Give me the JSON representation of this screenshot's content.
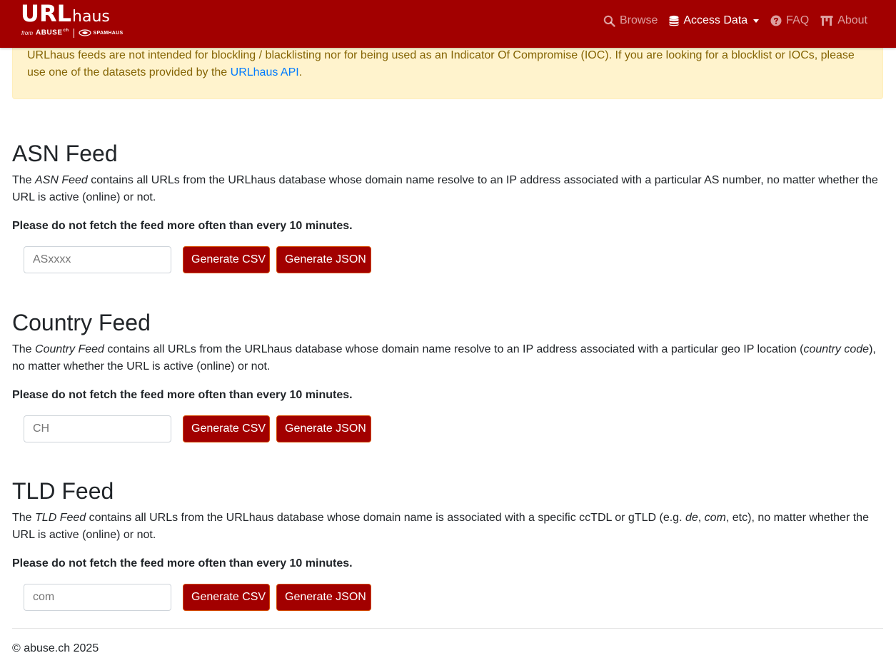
{
  "nav": {
    "brand": {
      "title_url": "URL",
      "title_haus": "haus",
      "from": "from",
      "abuse": "ABUSE",
      "abuse_ch": "ch",
      "spamhaus": "SPAMHAUS"
    },
    "items": [
      {
        "label": "Browse",
        "icon": "search-icon",
        "active": false
      },
      {
        "label": "Access Data",
        "icon": "database-icon",
        "active": true
      },
      {
        "label": "FAQ",
        "icon": "question-circle-icon",
        "active": false
      },
      {
        "label": "About",
        "icon": "building-icon",
        "active": false
      }
    ]
  },
  "alert": {
    "text": "URLhaus feeds are not intended for blockling / blacklisting nor for being used as an Indicator Of Compromise (IOC). If you are looking for a blocklist or IOCs, please use one of the datasets provided by the ",
    "link": "URLhaus API",
    "end": "."
  },
  "sections": {
    "asn": {
      "title": "ASN Feed",
      "desc_pre": "The ",
      "desc_em": "ASN Feed",
      "desc_post": " contains all URLs from the URLhaus database whose domain name resolve to an IP address associated with a particular AS number, no matter whether the URL is active (online) or not.",
      "warning": "Please do not fetch the feed more often than every 10 minutes.",
      "placeholder": "ASxxxx",
      "csv": "Generate CSV",
      "json": "Generate JSON"
    },
    "country": {
      "title": "Country Feed",
      "desc_pre": "The ",
      "desc_em": "Country Feed",
      "desc_mid": " contains all URLs from the URLhaus database whose domain name resolve to an IP address associated with a particular geo IP location (",
      "desc_em2": "country code",
      "desc_post": "), no matter whether the URL is active (online) or not.",
      "warning": "Please do not fetch the feed more often than every 10 minutes.",
      "placeholder": "CH",
      "csv": "Generate CSV",
      "json": "Generate JSON"
    },
    "tld": {
      "title": "TLD Feed",
      "desc_pre": "The ",
      "desc_em": "TLD Feed",
      "desc_mid": " contains all URLs from the URLhaus database whose domain name is associated with a specific ccTDL or gTLD (e.g. ",
      "desc_em2": "de",
      "desc_sep": ", ",
      "desc_em3": "com",
      "desc_post": ", etc), no matter whether the URL is active (online) or not.",
      "warning": "Please do not fetch the feed more often than every 10 minutes.",
      "placeholder": "com",
      "csv": "Generate CSV",
      "json": "Generate JSON"
    }
  },
  "footer": {
    "text": "© abuse.ch 2025"
  },
  "colors": {
    "brand": "#a20000",
    "alert_bg": "#fff3cd",
    "alert_text": "#856404",
    "link": "#007bff"
  }
}
